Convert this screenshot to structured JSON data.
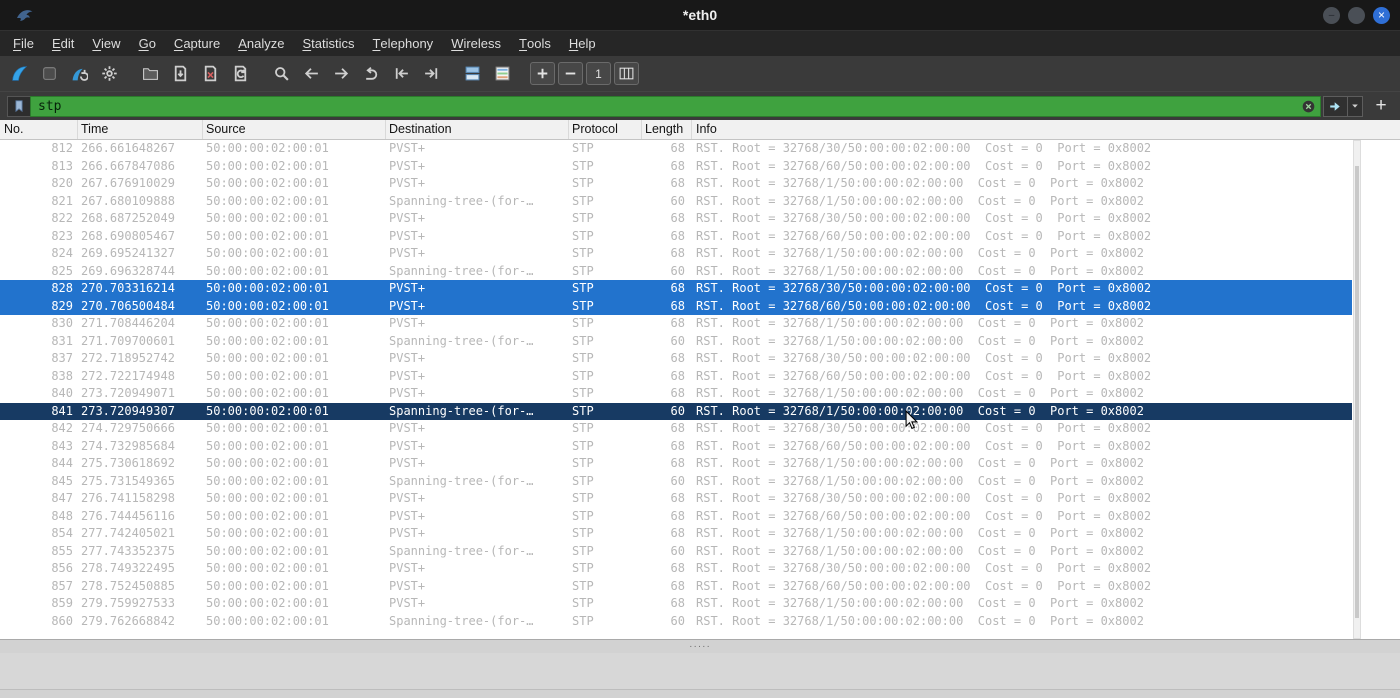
{
  "window": {
    "title": "*eth0"
  },
  "titlebar": {
    "minimize_glyph": "–",
    "maximize_glyph": "",
    "close_glyph": "×"
  },
  "menu": {
    "items": [
      "File",
      "Edit",
      "View",
      "Go",
      "Capture",
      "Analyze",
      "Statistics",
      "Telephony",
      "Wireless",
      "Tools",
      "Help"
    ]
  },
  "toolbar": {
    "icons": [
      "start-capture",
      "stop-capture",
      "restart-capture",
      "capture-options",
      "|",
      "open-file",
      "save-file",
      "close-file",
      "reload-file",
      "|",
      "find-packet",
      "go-back",
      "go-forward",
      "go-to-packet",
      "go-first-packet",
      "go-last-packet",
      "|",
      "auto-scroll",
      "colorize-packets",
      "|",
      "zoom-in",
      "zoom-out",
      "zoom-original",
      "resize-columns"
    ],
    "boxed": [
      "zoom-in",
      "zoom-out",
      "zoom-original",
      "resize-columns"
    ]
  },
  "filter": {
    "value": "stp",
    "add_label": "+"
  },
  "ui": {
    "splitter_dots": "·····"
  },
  "colors": {
    "selected_row_bg": "#2273cd",
    "focused_row_bg": "#173a63",
    "filter_valid_bg": "#3fa23f",
    "row_text": "#b7b7b7"
  },
  "packet_list": {
    "columns": [
      {
        "label": "No."
      },
      {
        "label": "Time"
      },
      {
        "label": "Source"
      },
      {
        "label": "Destination"
      },
      {
        "label": "Protocol"
      },
      {
        "label": "Length"
      },
      {
        "label": "Info"
      }
    ],
    "rows": [
      {
        "no": "812",
        "time": "266.661648267",
        "source": "50:00:00:02:00:01",
        "destination": "PVST+",
        "protocol": "STP",
        "length": "68",
        "info": "RST. Root = 32768/30/50:00:00:02:00:00  Cost = 0  Port = 0x8002",
        "state": "normal"
      },
      {
        "no": "813",
        "time": "266.667847086",
        "source": "50:00:00:02:00:01",
        "destination": "PVST+",
        "protocol": "STP",
        "length": "68",
        "info": "RST. Root = 32768/60/50:00:00:02:00:00  Cost = 0  Port = 0x8002",
        "state": "normal"
      },
      {
        "no": "820",
        "time": "267.676910029",
        "source": "50:00:00:02:00:01",
        "destination": "PVST+",
        "protocol": "STP",
        "length": "68",
        "info": "RST. Root = 32768/1/50:00:00:02:00:00  Cost = 0  Port = 0x8002",
        "state": "normal"
      },
      {
        "no": "821",
        "time": "267.680109888",
        "source": "50:00:00:02:00:01",
        "destination": "Spanning-tree-(for-…",
        "protocol": "STP",
        "length": "60",
        "info": "RST. Root = 32768/1/50:00:00:02:00:00  Cost = 0  Port = 0x8002",
        "state": "normal"
      },
      {
        "no": "822",
        "time": "268.687252049",
        "source": "50:00:00:02:00:01",
        "destination": "PVST+",
        "protocol": "STP",
        "length": "68",
        "info": "RST. Root = 32768/30/50:00:00:02:00:00  Cost = 0  Port = 0x8002",
        "state": "normal"
      },
      {
        "no": "823",
        "time": "268.690805467",
        "source": "50:00:00:02:00:01",
        "destination": "PVST+",
        "protocol": "STP",
        "length": "68",
        "info": "RST. Root = 32768/60/50:00:00:02:00:00  Cost = 0  Port = 0x8002",
        "state": "normal"
      },
      {
        "no": "824",
        "time": "269.695241327",
        "source": "50:00:00:02:00:01",
        "destination": "PVST+",
        "protocol": "STP",
        "length": "68",
        "info": "RST. Root = 32768/1/50:00:00:02:00:00  Cost = 0  Port = 0x8002",
        "state": "normal"
      },
      {
        "no": "825",
        "time": "269.696328744",
        "source": "50:00:00:02:00:01",
        "destination": "Spanning-tree-(for-…",
        "protocol": "STP",
        "length": "60",
        "info": "RST. Root = 32768/1/50:00:00:02:00:00  Cost = 0  Port = 0x8002",
        "state": "normal"
      },
      {
        "no": "828",
        "time": "270.703316214",
        "source": "50:00:00:02:00:01",
        "destination": "PVST+",
        "protocol": "STP",
        "length": "68",
        "info": "RST. Root = 32768/30/50:00:00:02:00:00  Cost = 0  Port = 0x8002",
        "state": "selected"
      },
      {
        "no": "829",
        "time": "270.706500484",
        "source": "50:00:00:02:00:01",
        "destination": "PVST+",
        "protocol": "STP",
        "length": "68",
        "info": "RST. Root = 32768/60/50:00:00:02:00:00  Cost = 0  Port = 0x8002",
        "state": "selected"
      },
      {
        "no": "830",
        "time": "271.708446204",
        "source": "50:00:00:02:00:01",
        "destination": "PVST+",
        "protocol": "STP",
        "length": "68",
        "info": "RST. Root = 32768/1/50:00:00:02:00:00  Cost = 0  Port = 0x8002",
        "state": "normal"
      },
      {
        "no": "831",
        "time": "271.709700601",
        "source": "50:00:00:02:00:01",
        "destination": "Spanning-tree-(for-…",
        "protocol": "STP",
        "length": "60",
        "info": "RST. Root = 32768/1/50:00:00:02:00:00  Cost = 0  Port = 0x8002",
        "state": "normal"
      },
      {
        "no": "837",
        "time": "272.718952742",
        "source": "50:00:00:02:00:01",
        "destination": "PVST+",
        "protocol": "STP",
        "length": "68",
        "info": "RST. Root = 32768/30/50:00:00:02:00:00  Cost = 0  Port = 0x8002",
        "state": "normal"
      },
      {
        "no": "838",
        "time": "272.722174948",
        "source": "50:00:00:02:00:01",
        "destination": "PVST+",
        "protocol": "STP",
        "length": "68",
        "info": "RST. Root = 32768/60/50:00:00:02:00:00  Cost = 0  Port = 0x8002",
        "state": "normal"
      },
      {
        "no": "840",
        "time": "273.720949071",
        "source": "50:00:00:02:00:01",
        "destination": "PVST+",
        "protocol": "STP",
        "length": "68",
        "info": "RST. Root = 32768/1/50:00:00:02:00:00  Cost = 0  Port = 0x8002",
        "state": "normal"
      },
      {
        "no": "841",
        "time": "273.720949307",
        "source": "50:00:00:02:00:01",
        "destination": "Spanning-tree-(for-…",
        "protocol": "STP",
        "length": "60",
        "info": "RST. Root = 32768/1/50:00:00:02:00:00  Cost = 0  Port = 0x8002",
        "state": "focused"
      },
      {
        "no": "842",
        "time": "274.729750666",
        "source": "50:00:00:02:00:01",
        "destination": "PVST+",
        "protocol": "STP",
        "length": "68",
        "info": "RST. Root = 32768/30/50:00:00:02:00:00  Cost = 0  Port = 0x8002",
        "state": "normal"
      },
      {
        "no": "843",
        "time": "274.732985684",
        "source": "50:00:00:02:00:01",
        "destination": "PVST+",
        "protocol": "STP",
        "length": "68",
        "info": "RST. Root = 32768/60/50:00:00:02:00:00  Cost = 0  Port = 0x8002",
        "state": "normal"
      },
      {
        "no": "844",
        "time": "275.730618692",
        "source": "50:00:00:02:00:01",
        "destination": "PVST+",
        "protocol": "STP",
        "length": "68",
        "info": "RST. Root = 32768/1/50:00:00:02:00:00  Cost = 0  Port = 0x8002",
        "state": "normal"
      },
      {
        "no": "845",
        "time": "275.731549365",
        "source": "50:00:00:02:00:01",
        "destination": "Spanning-tree-(for-…",
        "protocol": "STP",
        "length": "60",
        "info": "RST. Root = 32768/1/50:00:00:02:00:00  Cost = 0  Port = 0x8002",
        "state": "normal"
      },
      {
        "no": "847",
        "time": "276.741158298",
        "source": "50:00:00:02:00:01",
        "destination": "PVST+",
        "protocol": "STP",
        "length": "68",
        "info": "RST. Root = 32768/30/50:00:00:02:00:00  Cost = 0  Port = 0x8002",
        "state": "normal"
      },
      {
        "no": "848",
        "time": "276.744456116",
        "source": "50:00:00:02:00:01",
        "destination": "PVST+",
        "protocol": "STP",
        "length": "68",
        "info": "RST. Root = 32768/60/50:00:00:02:00:00  Cost = 0  Port = 0x8002",
        "state": "normal"
      },
      {
        "no": "854",
        "time": "277.742405021",
        "source": "50:00:00:02:00:01",
        "destination": "PVST+",
        "protocol": "STP",
        "length": "68",
        "info": "RST. Root = 32768/1/50:00:00:02:00:00  Cost = 0  Port = 0x8002",
        "state": "normal"
      },
      {
        "no": "855",
        "time": "277.743352375",
        "source": "50:00:00:02:00:01",
        "destination": "Spanning-tree-(for-…",
        "protocol": "STP",
        "length": "60",
        "info": "RST. Root = 32768/1/50:00:00:02:00:00  Cost = 0  Port = 0x8002",
        "state": "normal"
      },
      {
        "no": "856",
        "time": "278.749322495",
        "source": "50:00:00:02:00:01",
        "destination": "PVST+",
        "protocol": "STP",
        "length": "68",
        "info": "RST. Root = 32768/30/50:00:00:02:00:00  Cost = 0  Port = 0x8002",
        "state": "normal"
      },
      {
        "no": "857",
        "time": "278.752450885",
        "source": "50:00:00:02:00:01",
        "destination": "PVST+",
        "protocol": "STP",
        "length": "68",
        "info": "RST. Root = 32768/60/50:00:00:02:00:00  Cost = 0  Port = 0x8002",
        "state": "normal"
      },
      {
        "no": "859",
        "time": "279.759927533",
        "source": "50:00:00:02:00:01",
        "destination": "PVST+",
        "protocol": "STP",
        "length": "68",
        "info": "RST. Root = 32768/1/50:00:00:02:00:00  Cost = 0  Port = 0x8002",
        "state": "normal"
      },
      {
        "no": "860",
        "time": "279.762668842",
        "source": "50:00:00:02:00:01",
        "destination": "Spanning-tree-(for-…",
        "protocol": "STP",
        "length": "60",
        "info": "RST. Root = 32768/1/50:00:00:02:00:00  Cost = 0  Port = 0x8002",
        "state": "normal"
      }
    ]
  }
}
